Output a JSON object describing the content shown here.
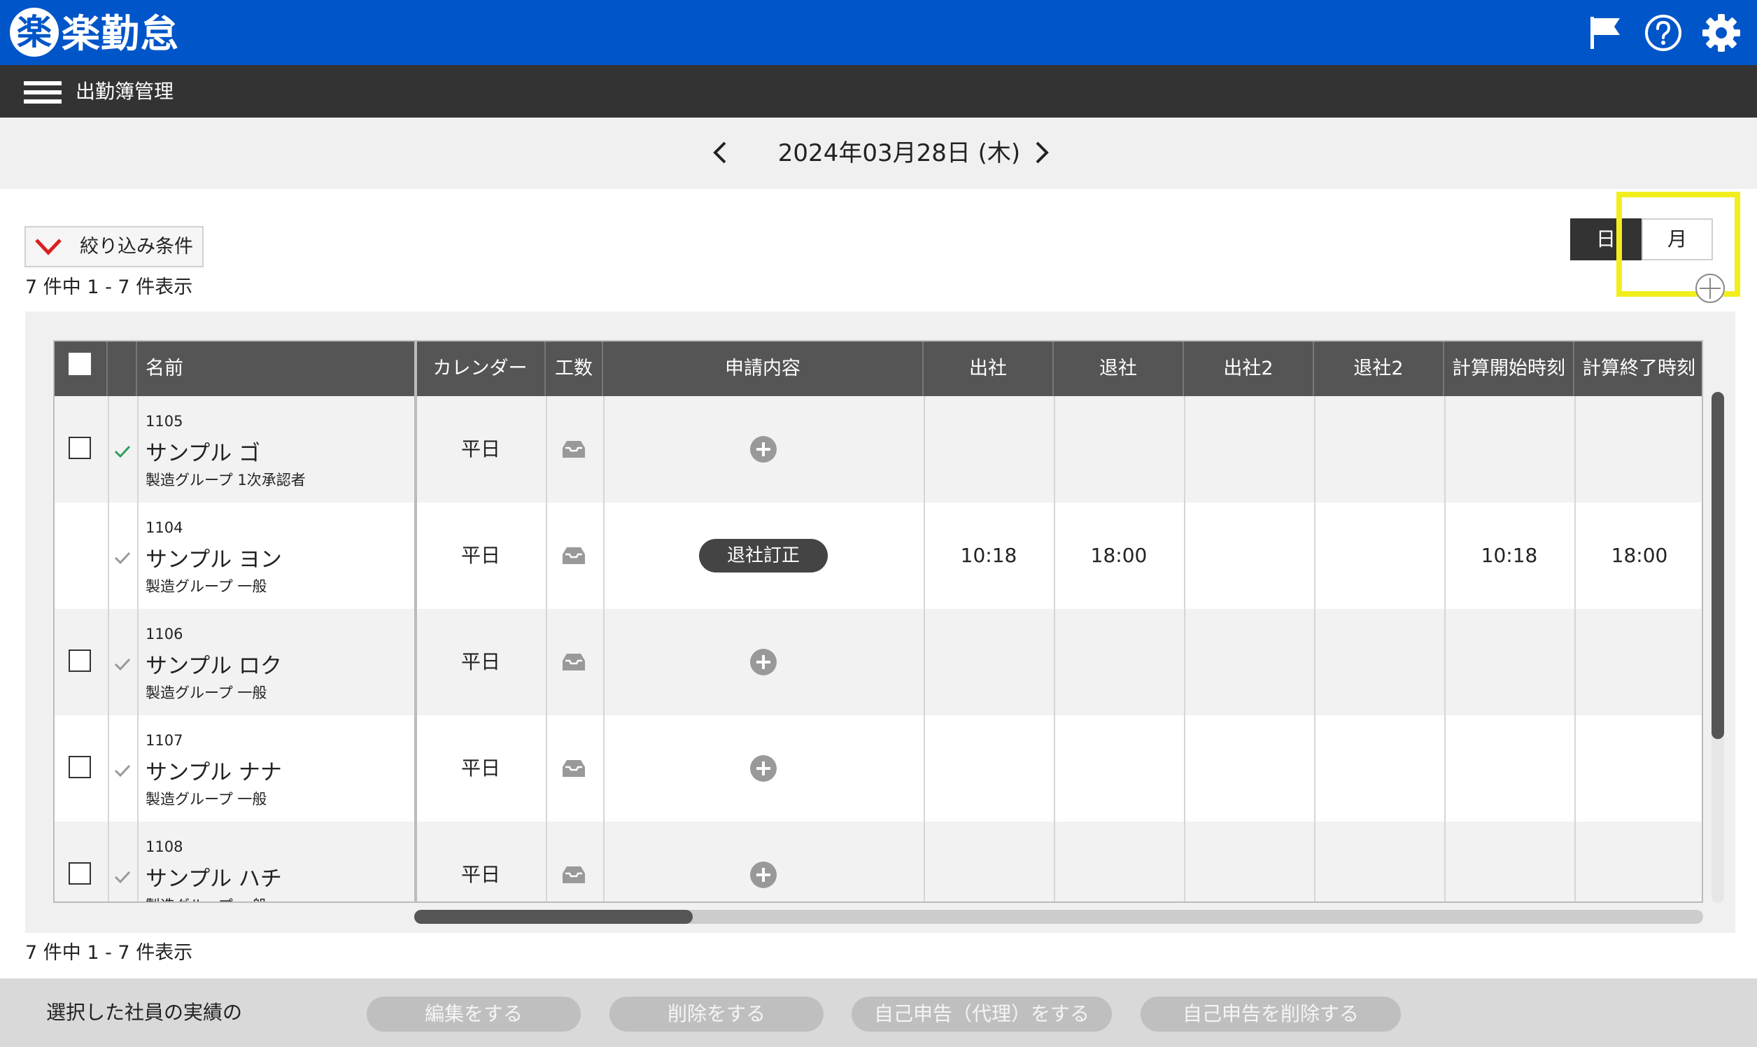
{
  "app": {
    "logo_char": "楽",
    "logo_name": "楽勤怠",
    "icons": [
      "flag-icon",
      "help-icon",
      "gear-icon"
    ]
  },
  "subheader": {
    "menu_icon": "hamburger-icon",
    "title": "出勤簿管理"
  },
  "date_nav": {
    "date": "2024年03月28日 (木)",
    "prev_icon": "chevron-left-icon",
    "next_icon": "chevron-right-icon"
  },
  "filter": {
    "label": "絞り込み条件",
    "icon": "chevron-down-icon"
  },
  "count_text": "7 件中 1 - 7 件表示",
  "view_toggle": {
    "day": "日",
    "month": "月",
    "selected": "日"
  },
  "table": {
    "headers": {
      "name": "名前",
      "calendar": "カレンダー",
      "workload": "工数",
      "request": "申請内容",
      "clock_in": "出社",
      "clock_out": "退社",
      "clock_in2": "出社2",
      "clock_out2": "退社2",
      "calc_start": "計算開始時刻",
      "calc_end": "計算終了時刻"
    },
    "rows": [
      {
        "id": "1105",
        "name": "サンプル ゴ",
        "group": "製造グループ 1次承認者",
        "calendar": "平日",
        "request": "",
        "clock_in": "",
        "clock_out": "",
        "clock_in2": "",
        "clock_out2": "",
        "calc_start": "",
        "calc_end": ""
      },
      {
        "id": "1104",
        "name": "サンプル ヨン",
        "group": "製造グループ 一般",
        "calendar": "平日",
        "request": "退社訂正",
        "clock_in": "10:18",
        "clock_out": "18:00",
        "clock_in2": "",
        "clock_out2": "",
        "calc_start": "10:18",
        "calc_end": "18:00"
      },
      {
        "id": "1106",
        "name": "サンプル ロク",
        "group": "製造グループ 一般",
        "calendar": "平日",
        "request": "",
        "clock_in": "",
        "clock_out": "",
        "clock_in2": "",
        "clock_out2": "",
        "calc_start": "",
        "calc_end": ""
      },
      {
        "id": "1107",
        "name": "サンプル ナナ",
        "group": "製造グループ 一般",
        "calendar": "平日",
        "request": "",
        "clock_in": "",
        "clock_out": "",
        "clock_in2": "",
        "clock_out2": "",
        "calc_start": "",
        "calc_end": ""
      },
      {
        "id": "1108",
        "name": "サンプル ハチ",
        "group": "製造グループ 一般",
        "calendar": "平日",
        "request": "",
        "clock_in": "",
        "clock_out": "",
        "clock_in2": "",
        "clock_out2": "",
        "calc_start": "",
        "calc_end": ""
      }
    ]
  },
  "footer": {
    "label": "選択した社員の実績の",
    "buttons": {
      "edit": "編集をする",
      "delete": "削除をする",
      "self_report_proxy": "自己申告（代理）をする",
      "delete_self_report": "自己申告を削除する"
    }
  },
  "colors": {
    "primary": "#0055c8",
    "subheader": "#333333",
    "highlight": "#f2ee1e",
    "check_green": "#2e9e5b"
  }
}
